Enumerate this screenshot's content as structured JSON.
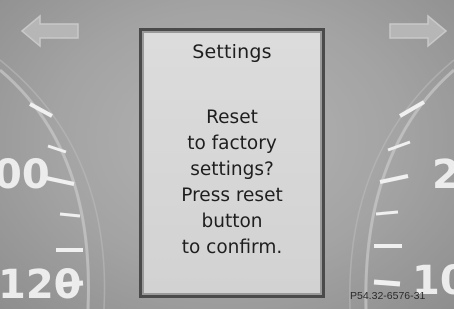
{
  "dialog": {
    "title": "Settings",
    "message_lines": [
      "Reset",
      "to factory",
      "settings?",
      "Press reset",
      "button",
      "to confirm."
    ]
  },
  "gauge_left": {
    "labels": [
      "00",
      "120"
    ]
  },
  "gauge_right": {
    "labels": [
      "2",
      "10"
    ]
  },
  "icons": {
    "left": "arrow-left-icon",
    "right": "arrow-right-icon"
  },
  "figure_reference": "P54.32-6576-31",
  "colors": {
    "background": "#a3a3a3",
    "panel": "#d6d6d6",
    "panel_border": "#4a4a4a",
    "text": "#1e1e1e",
    "gauge_marks": "#f0f0f0"
  }
}
